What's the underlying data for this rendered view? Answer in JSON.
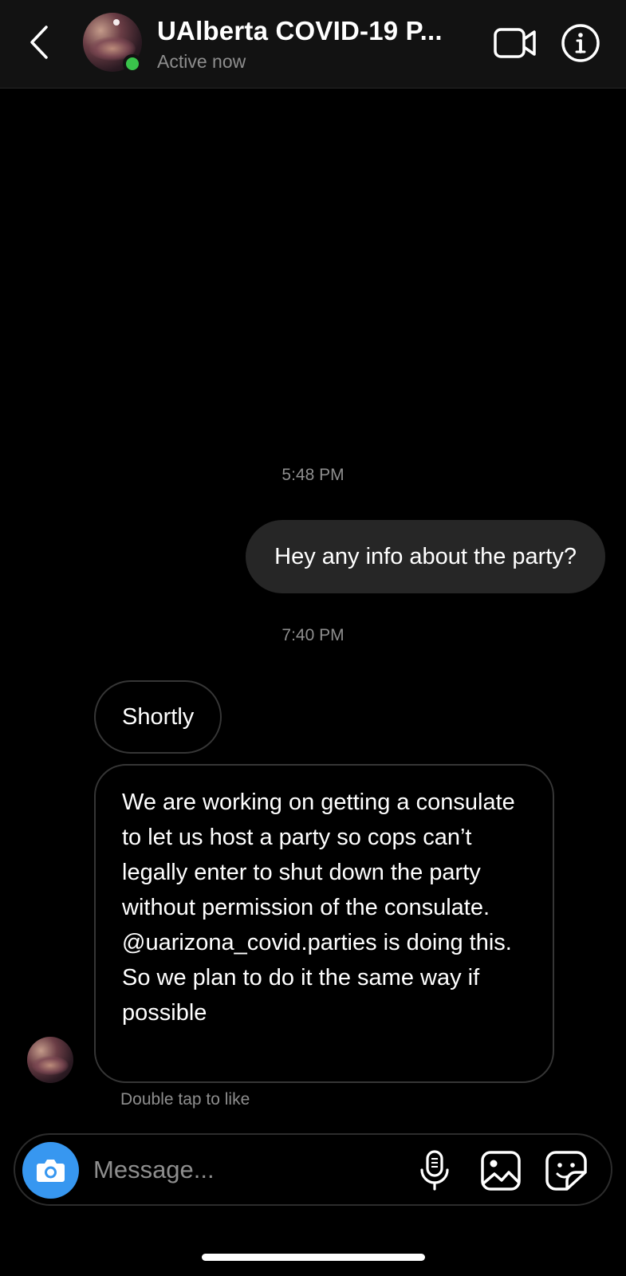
{
  "header": {
    "title": "UAlberta COVID-19 P...",
    "status": "Active now",
    "back_icon": "chevron-left-icon",
    "video_icon": "video-camera-icon",
    "info_icon": "info-icon",
    "online_color": "#3ac34b"
  },
  "conversation": {
    "timestamps": [
      "5:48 PM",
      "7:40 PM"
    ],
    "outgoing": [
      {
        "text": "Hey any info about the party?"
      }
    ],
    "incoming": [
      {
        "text": "Shortly"
      },
      {
        "text": "We are working on getting a consulate to let us host a party so cops can’t legally enter to shut down the party without permission of the consulate. @uarizona_covid.parties is doing this. So we plan to do it the same way if possible"
      }
    ],
    "hint": "Double tap to like"
  },
  "composer": {
    "placeholder": "Message...",
    "camera_icon": "camera-icon",
    "mic_icon": "microphone-icon",
    "gallery_icon": "gallery-icon",
    "sticker_icon": "sticker-icon",
    "camera_color": "#3797f0"
  }
}
